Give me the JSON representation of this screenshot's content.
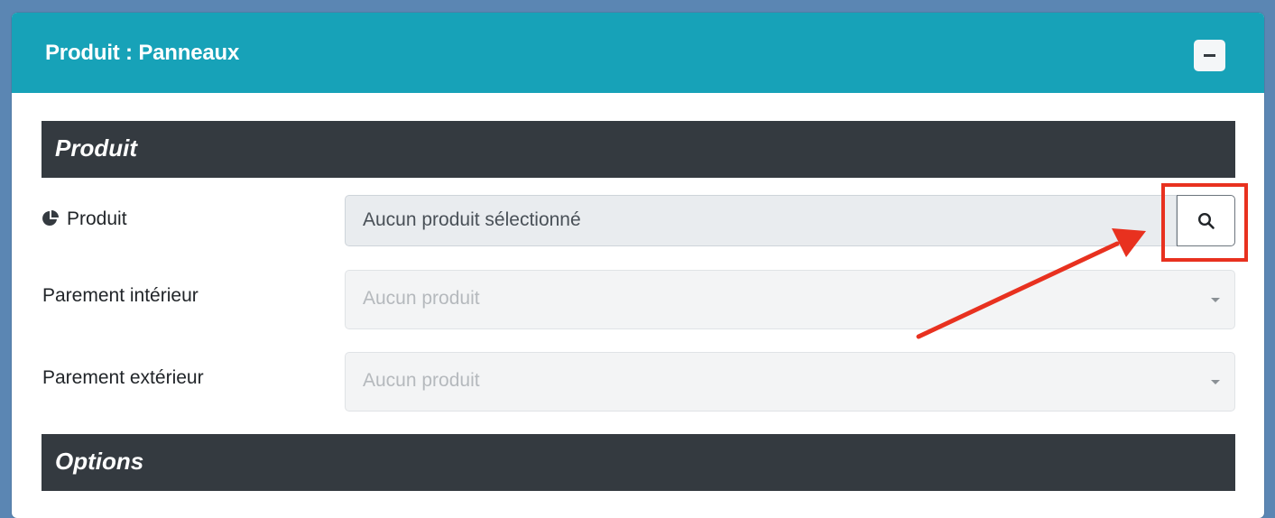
{
  "panel": {
    "title": "Produit : Panneaux",
    "collapse_icon": "minus-icon"
  },
  "sections": {
    "produit": {
      "title": "Produit"
    },
    "options": {
      "title": "Options"
    }
  },
  "fields": {
    "produit": {
      "label": "Produit",
      "icon": "chart-pie-icon",
      "value": "Aucun produit sélectionné",
      "search_icon": "search-icon"
    },
    "parement_interieur": {
      "label": "Parement intérieur",
      "placeholder": "Aucun produit"
    },
    "parement_exterieur": {
      "label": "Parement extérieur",
      "placeholder": "Aucun produit"
    }
  },
  "annotation": {
    "color": "#e8311f"
  },
  "colors": {
    "header": "#17a2b8",
    "section_bar": "#343a40",
    "background": "#5b86b3"
  }
}
